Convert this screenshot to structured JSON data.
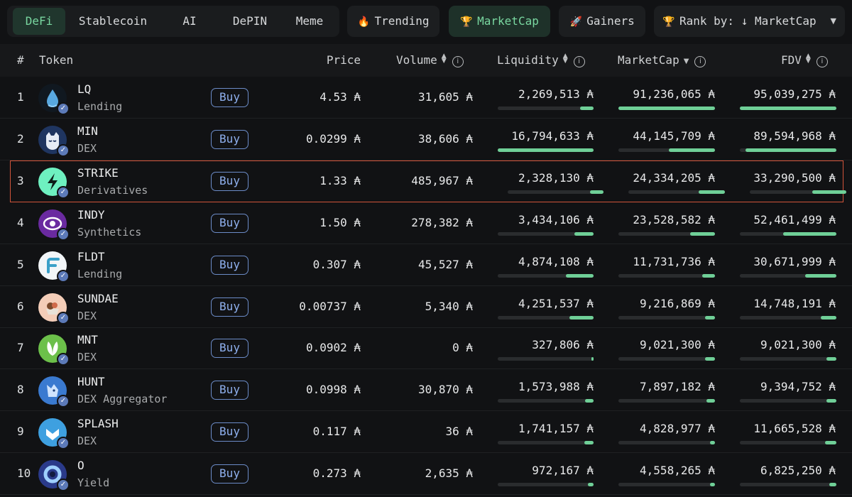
{
  "tabs": {
    "categories": [
      {
        "label": "DeFi",
        "active": true
      },
      {
        "label": "Stablecoin",
        "active": false
      },
      {
        "label": "AI",
        "active": false
      },
      {
        "label": "DePIN",
        "active": false
      },
      {
        "label": "Meme",
        "active": false
      }
    ],
    "trending": {
      "label": "Trending",
      "icon": "fire-icon",
      "glyph": "🔥"
    },
    "marketcap": {
      "label": "MarketCap",
      "icon": "trophy-icon",
      "glyph": "🏆"
    },
    "gainers": {
      "label": "Gainers",
      "icon": "rocket-icon",
      "glyph": "🚀"
    },
    "rank_by": {
      "label": "Rank by: ↓ MarketCap",
      "icon": "trophy-icon",
      "glyph": "🏆"
    }
  },
  "columns": {
    "rank": "#",
    "token": "Token",
    "price": "Price",
    "volume": "Volume",
    "liquidity": "Liquidity",
    "marketcap": "MarketCap",
    "fdv": "FDV",
    "info_glyph": "i"
  },
  "buy_label": "Buy",
  "currency_symbol": "₳",
  "accent_color": "#6fcf97",
  "highlight_color": "#d2543a",
  "tokens": [
    {
      "rank": "1",
      "symbol": "LQ",
      "category": "Lending",
      "price": "4.53 ₳",
      "volume": "31,605 ₳",
      "liquidity": "2,269,513 ₳",
      "marketcap": "91,236,065 ₳",
      "fdv": "95,039,275 ₳",
      "liq_fill": 0.14,
      "mc_fill": 1.0,
      "fdv_fill": 1.0,
      "logo": {
        "bg": "#101820",
        "fg": "#58a8e0",
        "icon": "droplet-icon"
      }
    },
    {
      "rank": "2",
      "symbol": "MIN",
      "category": "DEX",
      "price": "0.0299 ₳",
      "volume": "38,606 ₳",
      "liquidity": "16,794,633 ₳",
      "marketcap": "44,145,709 ₳",
      "fdv": "89,594,968 ₳",
      "liq_fill": 1.0,
      "mc_fill": 0.48,
      "fdv_fill": 0.94,
      "logo": {
        "bg": "#1f3560",
        "fg": "#e6ecf6",
        "icon": "cat-icon"
      }
    },
    {
      "rank": "3",
      "symbol": "STRIKE",
      "category": "Derivatives",
      "price": "1.33 ₳",
      "volume": "485,967 ₳",
      "liquidity": "2,328,130 ₳",
      "marketcap": "24,334,205 ₳",
      "fdv": "33,290,500 ₳",
      "liq_fill": 0.14,
      "mc_fill": 0.27,
      "fdv_fill": 0.35,
      "highlight": true,
      "logo": {
        "bg": "#6ef0c0",
        "fg": "#0e1d18",
        "icon": "lightning-icon"
      }
    },
    {
      "rank": "4",
      "symbol": "INDY",
      "category": "Synthetics",
      "price": "1.50 ₳",
      "volume": "278,382 ₳",
      "liquidity": "3,434,106 ₳",
      "marketcap": "23,528,582 ₳",
      "fdv": "52,461,499 ₳",
      "liq_fill": 0.2,
      "mc_fill": 0.26,
      "fdv_fill": 0.55,
      "logo": {
        "bg": "#6a2aa0",
        "fg": "#ffffff",
        "icon": "eye-icon"
      }
    },
    {
      "rank": "5",
      "symbol": "FLDT",
      "category": "Lending",
      "price": "0.307 ₳",
      "volume": "45,527 ₳",
      "liquidity": "4,874,108 ₳",
      "marketcap": "11,731,736 ₳",
      "fdv": "30,671,999 ₳",
      "liq_fill": 0.29,
      "mc_fill": 0.13,
      "fdv_fill": 0.32,
      "logo": {
        "bg": "#f2f6f8",
        "fg": "#3aa0c8",
        "icon": "f-logo-icon"
      }
    },
    {
      "rank": "6",
      "symbol": "SUNDAE",
      "category": "DEX",
      "price": "0.00737 ₳",
      "volume": "5,340 ₳",
      "liquidity": "4,251,537 ₳",
      "marketcap": "9,216,869 ₳",
      "fdv": "14,748,191 ₳",
      "liq_fill": 0.25,
      "mc_fill": 0.1,
      "fdv_fill": 0.16,
      "logo": {
        "bg": "#f4cdb8",
        "fg": "#7a4a2c",
        "icon": "sundae-icon"
      }
    },
    {
      "rank": "7",
      "symbol": "MNT",
      "category": "DEX",
      "price": "0.0902 ₳",
      "volume": "0 ₳",
      "liquidity": "327,806 ₳",
      "marketcap": "9,021,300 ₳",
      "fdv": "9,021,300 ₳",
      "liq_fill": 0.02,
      "mc_fill": 0.1,
      "fdv_fill": 0.1,
      "logo": {
        "bg": "#6cc04a",
        "fg": "#ffffff",
        "icon": "leaf-icon"
      }
    },
    {
      "rank": "8",
      "symbol": "HUNT",
      "category": "DEX Aggregator",
      "price": "0.0998 ₳",
      "volume": "30,870 ₳",
      "liquidity": "1,573,988 ₳",
      "marketcap": "7,897,182 ₳",
      "fdv": "9,394,752 ₳",
      "liq_fill": 0.09,
      "mc_fill": 0.09,
      "fdv_fill": 0.1,
      "logo": {
        "bg": "#3a7ad0",
        "fg": "#cfe4ff",
        "icon": "fox-icon"
      }
    },
    {
      "rank": "9",
      "symbol": "SPLASH",
      "category": "DEX",
      "price": "0.117 ₳",
      "volume": "36 ₳",
      "liquidity": "1,741,157 ₳",
      "marketcap": "4,828,977 ₳",
      "fdv": "11,665,528 ₳",
      "liq_fill": 0.1,
      "mc_fill": 0.05,
      "fdv_fill": 0.12,
      "logo": {
        "bg": "#3ea0e0",
        "fg": "#ffffff",
        "icon": "splash-icon"
      }
    },
    {
      "rank": "10",
      "symbol": "O",
      "category": "Yield",
      "price": "0.273 ₳",
      "volume": "2,635 ₳",
      "liquidity": "972,167 ₳",
      "marketcap": "4,558,265 ₳",
      "fdv": "6,825,250 ₳",
      "liq_fill": 0.06,
      "mc_fill": 0.05,
      "fdv_fill": 0.07,
      "logo": {
        "bg": "#2a3a8a",
        "fg": "#9fd0ff",
        "icon": "ring-icon"
      }
    }
  ]
}
